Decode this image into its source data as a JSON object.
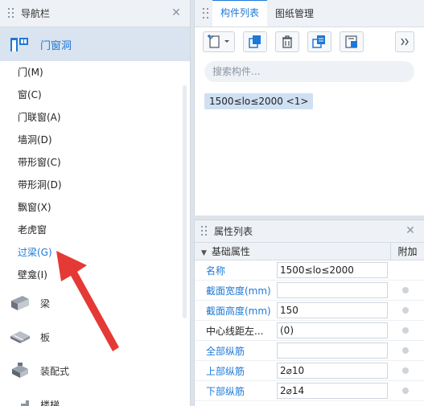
{
  "nav": {
    "title": "导航栏",
    "active_category": "门窗洞",
    "items": [
      "门(M)",
      "窗(C)",
      "门联窗(A)",
      "墙洞(D)",
      "带形窗(C)",
      "带形洞(D)",
      "飘窗(X)",
      "老虎窗",
      "过梁(G)",
      "壁龛(I)"
    ],
    "highlighted_item": "过梁(G)",
    "categories": [
      {
        "label": "梁",
        "icon": "beam-icon"
      },
      {
        "label": "板",
        "icon": "slab-icon"
      },
      {
        "label": "装配式",
        "icon": "prefab-icon"
      },
      {
        "label": "楼梯",
        "icon": "stair-icon"
      }
    ]
  },
  "component_panel": {
    "tabs": [
      "构件列表",
      "图纸管理"
    ],
    "active_tab": "构件列表",
    "search_placeholder": "搜索构件...",
    "selected_component": "1500≤lo≤2000 <1>",
    "toolbar_icons": [
      "new-icon",
      "copy-icon",
      "delete-icon",
      "layer-copy-icon",
      "import-icon",
      "more-icon"
    ]
  },
  "properties_panel": {
    "title": "属性列表",
    "group_label": "基础属性",
    "extra_col": "附加",
    "rows": [
      {
        "name": "名称",
        "value": "1500≤lo≤2000"
      },
      {
        "name": "截面宽度(mm)",
        "value": ""
      },
      {
        "name": "截面高度(mm)",
        "value": "150"
      },
      {
        "name": "中心线距左...",
        "value": "(0)"
      },
      {
        "name": "全部纵筋",
        "value": ""
      },
      {
        "name": "上部纵筋",
        "value": "2⌀10"
      },
      {
        "name": "下部纵筋",
        "value": "2⌀14"
      }
    ]
  },
  "colors": {
    "accent": "#1e78d7",
    "annotation_arrow": "#e53935"
  }
}
